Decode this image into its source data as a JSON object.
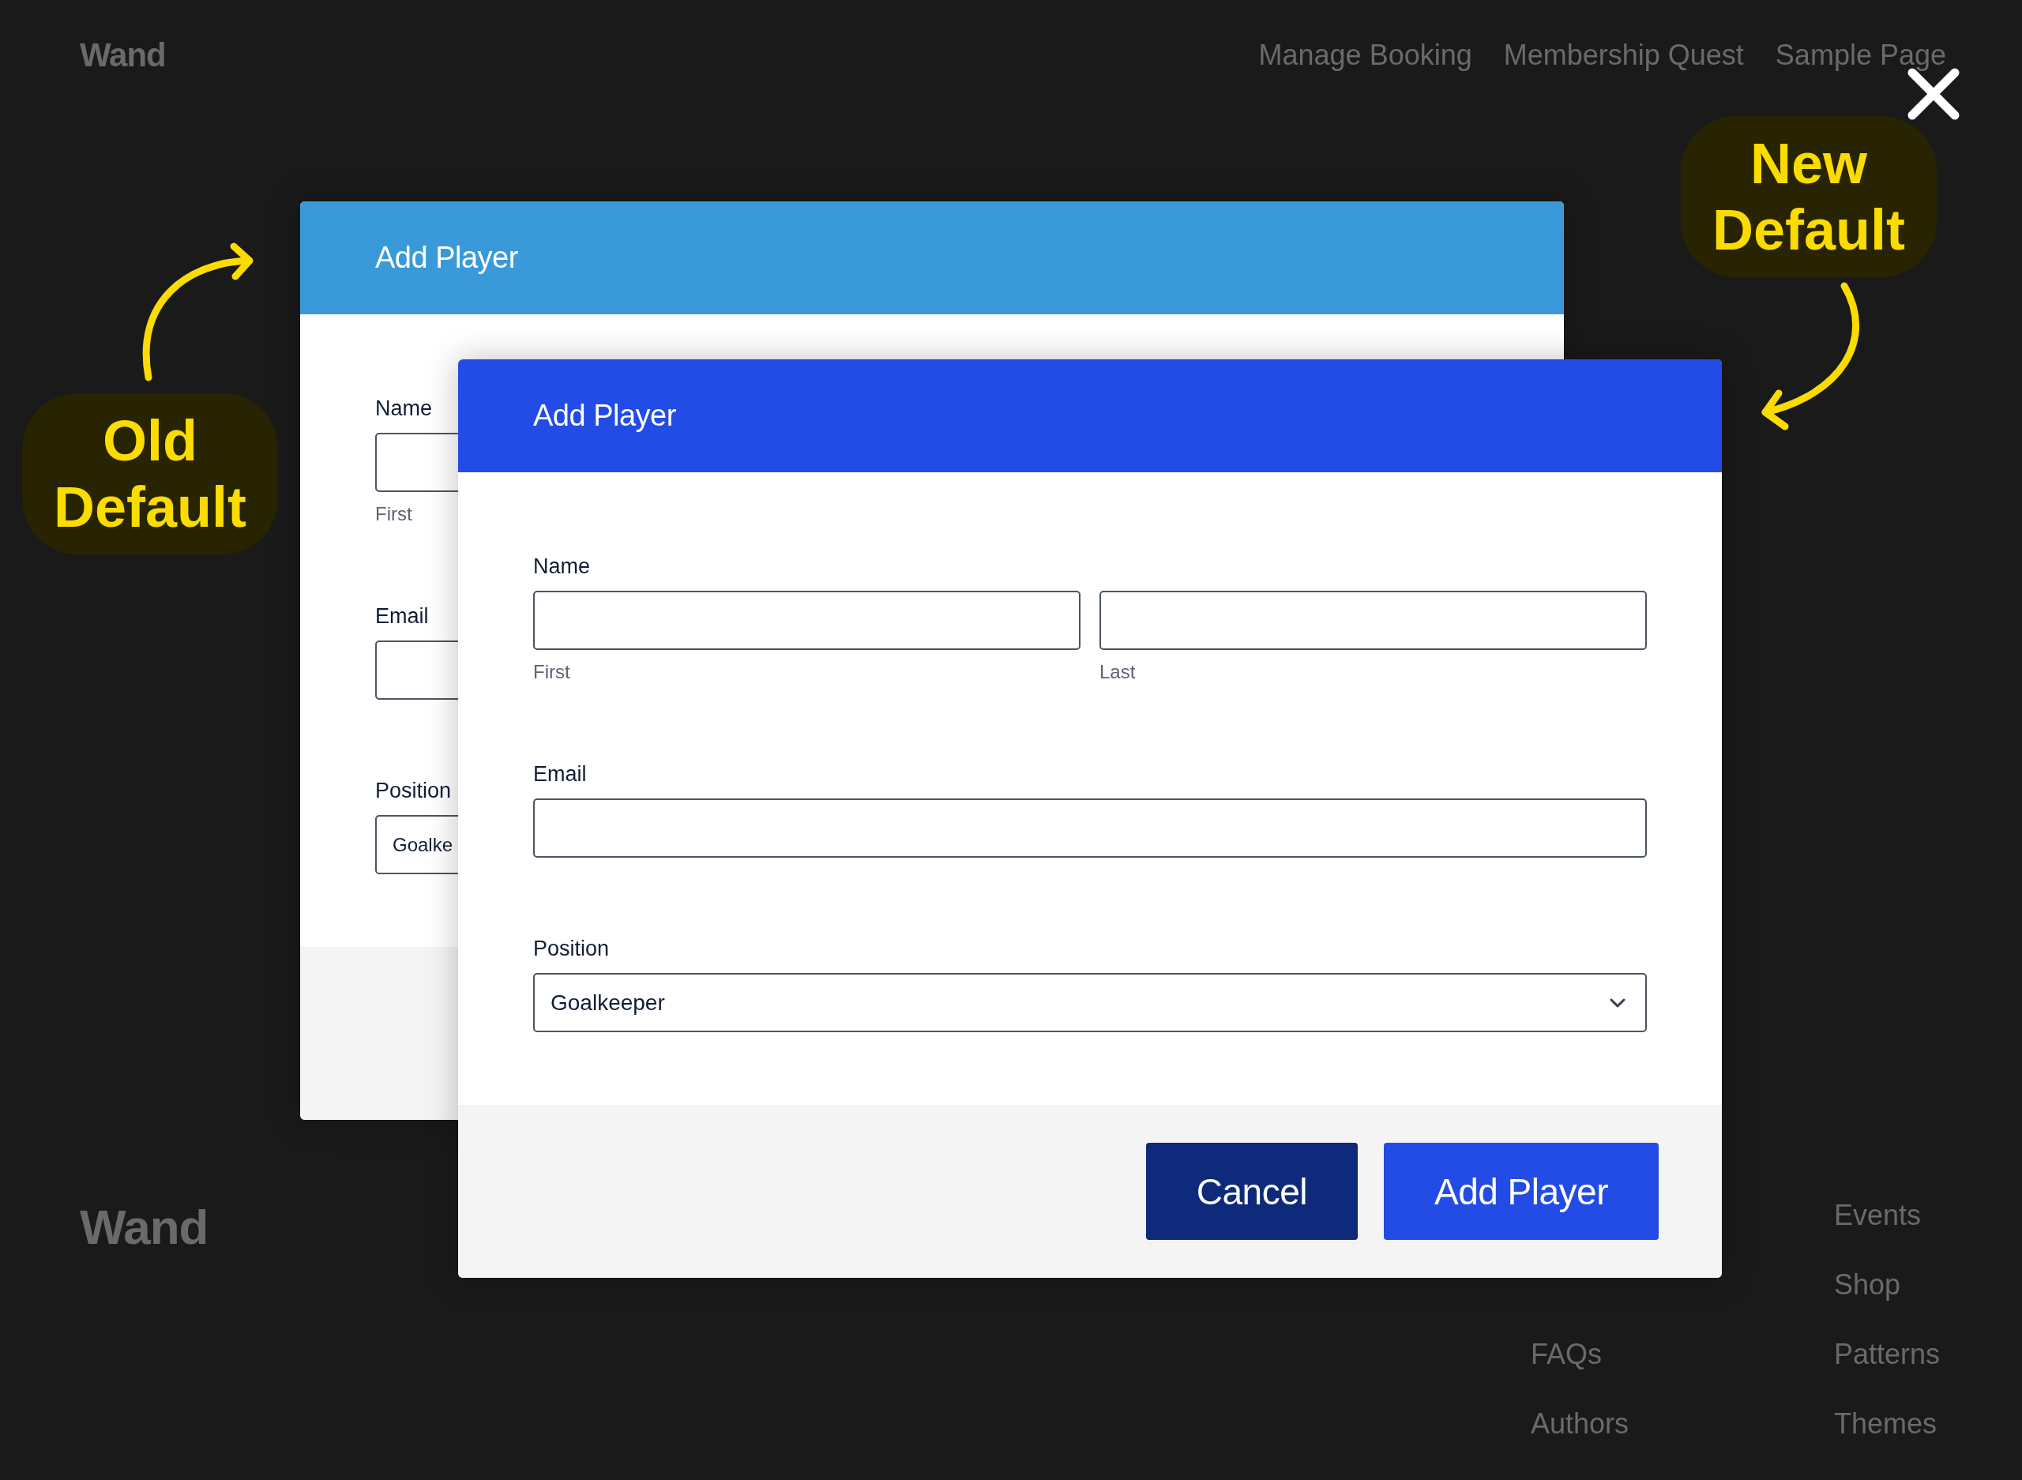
{
  "site_header": {
    "logo": "Wand",
    "nav": [
      "Manage Booking",
      "Membership Quest",
      "Sample Page"
    ]
  },
  "annotations": [
    {
      "kind": "old",
      "label": "Old Default"
    },
    {
      "kind": "new",
      "label": "New Default"
    }
  ],
  "old_dialog": {
    "title": "Add Player",
    "fields": [
      {
        "kind": "name",
        "label": "Name",
        "sublabels": [
          "First"
        ]
      },
      {
        "kind": "text",
        "label": "Email"
      },
      {
        "kind": "select",
        "label": "Position",
        "value": "Goalke"
      }
    ]
  },
  "new_dialog": {
    "title": "Add Player",
    "fields": [
      {
        "kind": "name",
        "label": "Name",
        "sublabels": [
          "First",
          "Last"
        ]
      },
      {
        "kind": "text",
        "label": "Email"
      },
      {
        "kind": "select",
        "label": "Position",
        "value": "Goalkeeper"
      }
    ],
    "buttons": [
      {
        "kind": "secondary",
        "label": "Cancel"
      },
      {
        "kind": "primary",
        "label": "Add Player"
      }
    ]
  },
  "site_footer": {
    "logo": "Wand",
    "links_column_1": [
      "FAQs",
      "Authors"
    ],
    "links_column_2": [
      "Events",
      "Shop",
      "Patterns",
      "Themes"
    ]
  }
}
